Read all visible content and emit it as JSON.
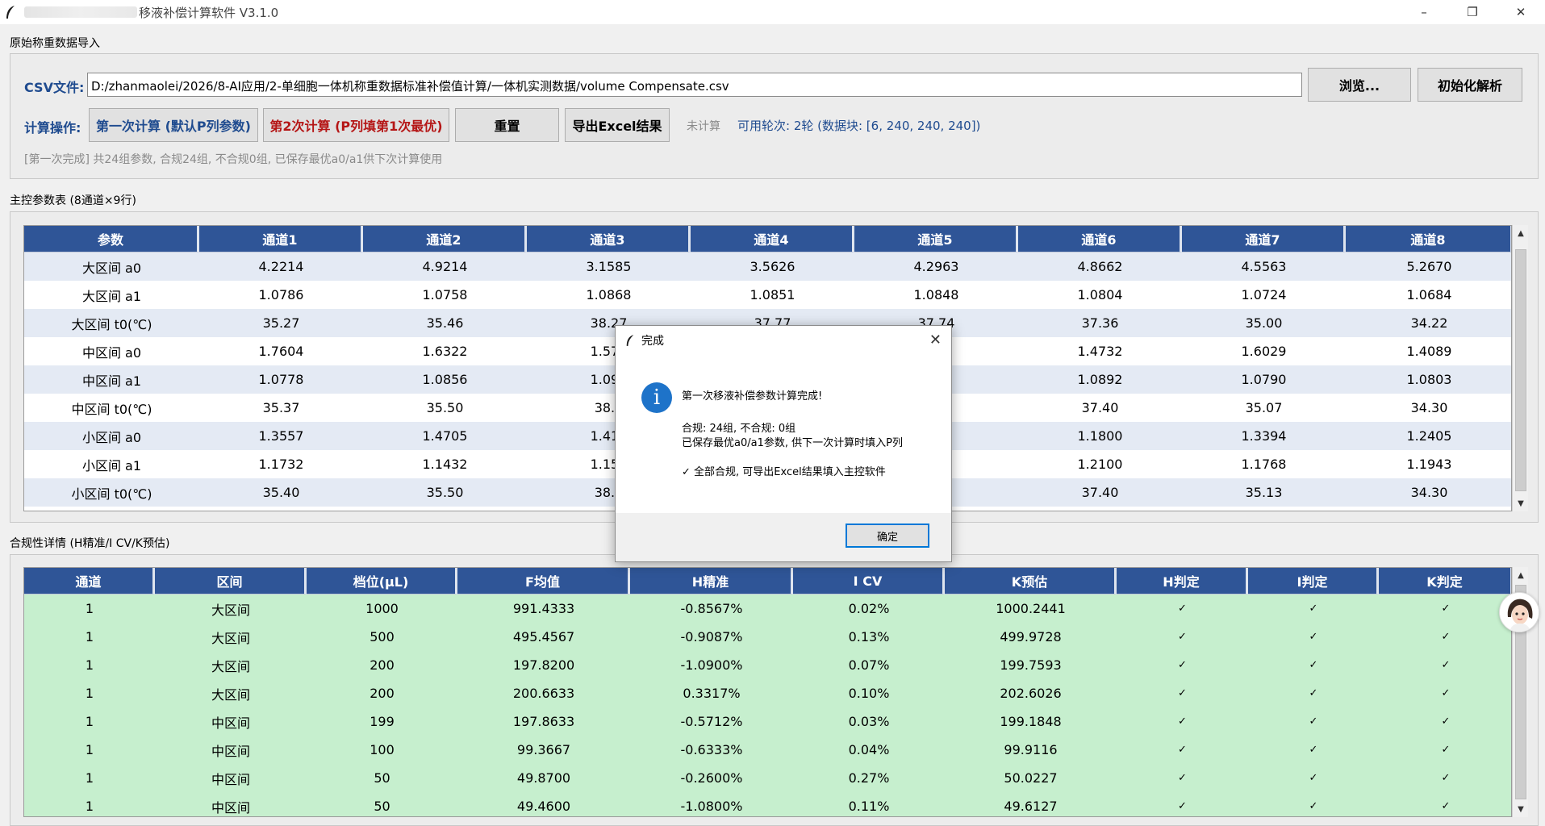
{
  "window": {
    "title": "移液补偿计算软件 V3.1.0",
    "minimize": "–",
    "maximize": "❐",
    "close": "✕"
  },
  "import_section": {
    "label": "原始称重数据导入",
    "csv_label": "CSV文件:",
    "csv_path": "D:/zhanmaolei/2026/8-AI应用/2-单细胞一体机称重数据标准补偿值计算/一体机实测数据/volume Compensate.csv",
    "browse_button": "浏览...",
    "init_button": "初始化解析",
    "calc_label": "计算操作:",
    "calc1_button": "第一次计算 (默认P列参数)",
    "calc2_button": "第2次计算 (P列填第1次最优)",
    "reset_button": "重置",
    "export_button": "导出Excel结果",
    "status_idle": "未计算",
    "status_rounds": "可用轮次: 2轮 (数据块: [6, 240, 240, 240])",
    "log_message": "[第一次完成] 共24组参数, 合规24组, 不合规0组, 已保存最优a0/a1供下次计算使用"
  },
  "params_section": {
    "label": "主控参数表 (8通道×9行)",
    "headers": [
      "参数",
      "通道1",
      "通道2",
      "通道3",
      "通道4",
      "通道5",
      "通道6",
      "通道7",
      "通道8"
    ],
    "rows": [
      [
        "大区间 a0",
        "4.2214",
        "4.9214",
        "3.1585",
        "3.5626",
        "4.2963",
        "4.8662",
        "4.5563",
        "5.2670"
      ],
      [
        "大区间 a1",
        "1.0786",
        "1.0758",
        "1.0868",
        "1.0851",
        "1.0848",
        "1.0804",
        "1.0724",
        "1.0684"
      ],
      [
        "大区间 t0(℃)",
        "35.27",
        "35.46",
        "38.27",
        "37.77",
        "37.74",
        "37.36",
        "35.00",
        "34.22"
      ],
      [
        "中区间 a0",
        "1.7604",
        "1.6322",
        "1.577",
        "",
        "9",
        "1.4732",
        "1.6029",
        "1.4089"
      ],
      [
        "中区间 a1",
        "1.0778",
        "1.0856",
        "1.093",
        "",
        "2",
        "1.0892",
        "1.0790",
        "1.0803"
      ],
      [
        "中区间 t0(℃)",
        "35.37",
        "35.50",
        "38.3",
        "",
        "",
        "37.40",
        "35.07",
        "34.30"
      ],
      [
        "小区间 a0",
        "1.3557",
        "1.4705",
        "1.417",
        "",
        "3",
        "1.1800",
        "1.3394",
        "1.2405"
      ],
      [
        "小区间 a1",
        "1.1732",
        "1.1432",
        "1.157",
        "",
        "0",
        "1.2100",
        "1.1768",
        "1.1943"
      ],
      [
        "小区间 t0(℃)",
        "35.40",
        "35.50",
        "38.4",
        "",
        "",
        "37.40",
        "35.13",
        "34.30"
      ]
    ]
  },
  "compliance_section": {
    "label": "合规性详情 (H精准/I CV/K预估)",
    "headers": [
      "通道",
      "区间",
      "档位(μL)",
      "F均值",
      "H精准",
      "I CV",
      "K预估",
      "H判定",
      "I判定",
      "K判定"
    ],
    "rows": [
      [
        "1",
        "大区间",
        "1000",
        "991.4333",
        "-0.8567%",
        "0.02%",
        "1000.2441",
        "✓",
        "✓",
        "✓"
      ],
      [
        "1",
        "大区间",
        "500",
        "495.4567",
        "-0.9087%",
        "0.13%",
        "499.9728",
        "✓",
        "✓",
        "✓"
      ],
      [
        "1",
        "大区间",
        "200",
        "197.8200",
        "-1.0900%",
        "0.07%",
        "199.7593",
        "✓",
        "✓",
        "✓"
      ],
      [
        "1",
        "大区间",
        "200",
        "200.6633",
        "0.3317%",
        "0.10%",
        "202.6026",
        "✓",
        "✓",
        "✓"
      ],
      [
        "1",
        "中区间",
        "199",
        "197.8633",
        "-0.5712%",
        "0.03%",
        "199.1848",
        "✓",
        "✓",
        "✓"
      ],
      [
        "1",
        "中区间",
        "100",
        "99.3667",
        "-0.6333%",
        "0.04%",
        "99.9116",
        "✓",
        "✓",
        "✓"
      ],
      [
        "1",
        "中区间",
        "50",
        "49.8700",
        "-0.2600%",
        "0.27%",
        "50.0227",
        "✓",
        "✓",
        "✓"
      ],
      [
        "1",
        "中区间",
        "50",
        "49.4600",
        "-1.0800%",
        "0.11%",
        "49.6127",
        "✓",
        "✓",
        "✓"
      ]
    ]
  },
  "dialog": {
    "title": "完成",
    "close": "✕",
    "icon": "i",
    "line1": "第一次移液补偿参数计算完成!",
    "line2": "合规: 24组, 不合规: 0组",
    "line3": "已保存最优a0/a1参数, 供下一次计算时填入P列",
    "line4": "✓ 全部合规, 可导出Excel结果填入主控软件",
    "ok_button": "确定"
  },
  "colors": {
    "header_blue": "#2f5597",
    "row_green": "#c6efce",
    "row_blue": "#e4eaf4",
    "accent_red": "#b51616",
    "label_blue": "#1f4b8f"
  }
}
